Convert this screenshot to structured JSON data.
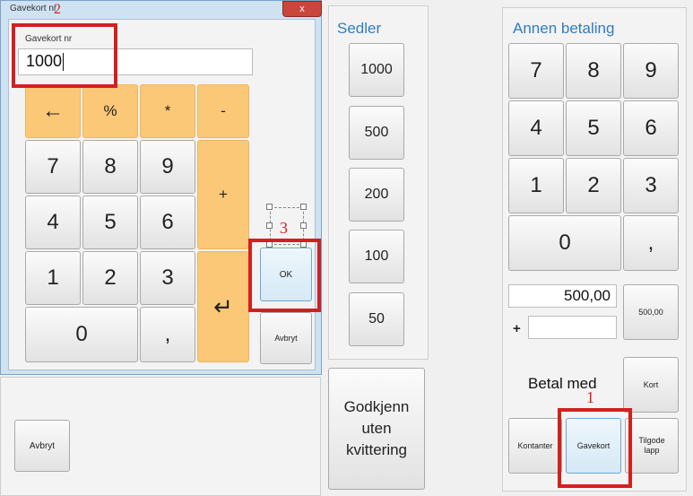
{
  "dialog": {
    "title": "Gavekort nr",
    "field_label": "Gavekort nr",
    "field_value": "1000",
    "keypad": {
      "backspace": "←",
      "percent": "%",
      "multiply": "*",
      "minus": "-",
      "plus": "+",
      "enter": "↵",
      "digits": [
        "7",
        "8",
        "9",
        "4",
        "5",
        "6",
        "1",
        "2",
        "3"
      ],
      "zero": "0",
      "comma": ","
    },
    "ok_label": "OK",
    "cancel_label": "Avbryt"
  },
  "sedler": {
    "header": "Sedler",
    "notes": [
      "1000",
      "500",
      "200",
      "100",
      "50"
    ]
  },
  "godkjenn_label": "Godkjenn uten kvittering",
  "annen": {
    "header": "Annen betaling",
    "digits": [
      "7",
      "8",
      "9",
      "4",
      "5",
      "6",
      "1",
      "2",
      "3"
    ],
    "zero": "0",
    "comma": ",",
    "amount_value": "500,00",
    "plus_sign": "+",
    "amount_button": "500,00",
    "betal_med": "Betal med",
    "kort": "Kort",
    "kontanter": "Kontanter",
    "gavekort": "Gavekort",
    "tilgode": "Tilgode lapp"
  },
  "bottom_cancel_label": "Avbryt",
  "annotations": {
    "one": "1",
    "two": "2",
    "three": "3"
  },
  "colors": {
    "accent_blue": "#2f7ec0",
    "keypad_orange": "#fbc878",
    "annotation_red": "#d3201f"
  }
}
